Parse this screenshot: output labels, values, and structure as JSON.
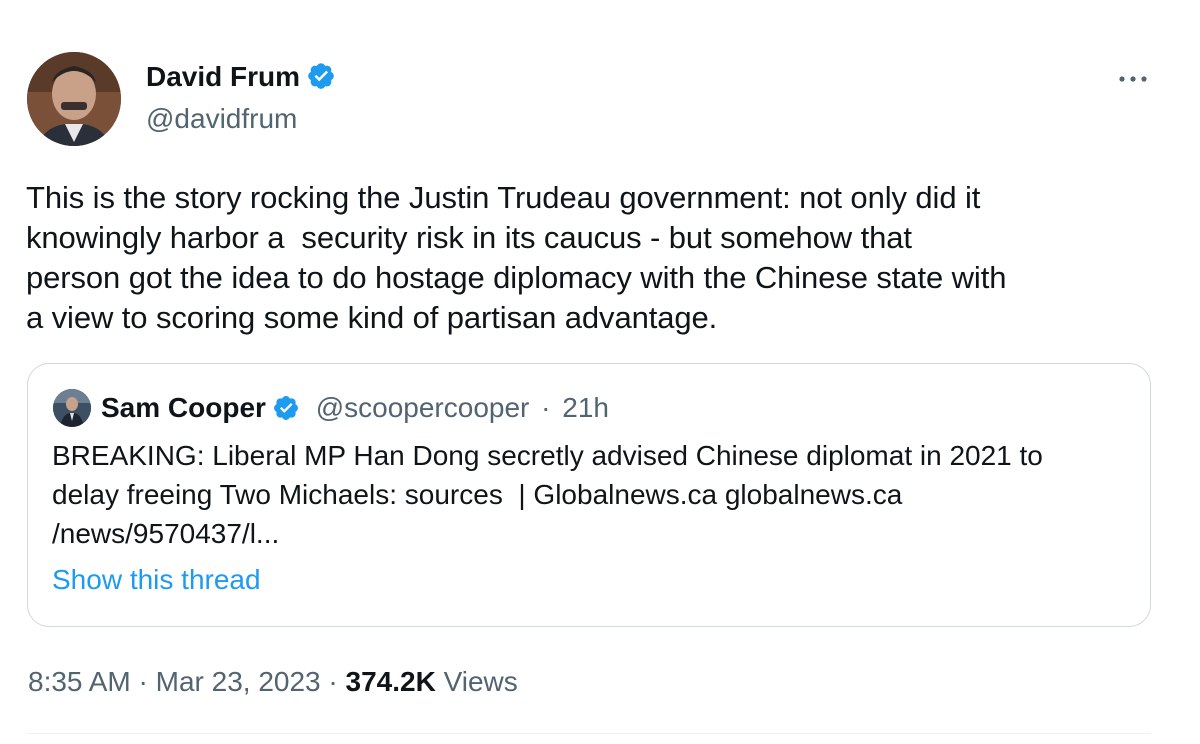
{
  "author": {
    "name": "David Frum",
    "handle": "@davidfrum",
    "verified_icon": "verified-badge-icon"
  },
  "more_icon": "more-options-icon",
  "tweet": {
    "lines": [
      "This is the story rocking the Justin Trudeau government: not only did it",
      "knowingly harbor a  security risk in its caucus - but somehow that",
      "person got the idea to do hostage diplomacy with the Chinese state with",
      "a view to scoring some kind of partisan advantage."
    ]
  },
  "quoted": {
    "name": "Sam Cooper",
    "handle": "@scoopercooper",
    "separator": "·",
    "time": "21h",
    "lines": [
      "BREAKING: Liberal MP Han Dong secretly advised Chinese diplomat in 2021 to",
      "delay freeing Two Michaels: sources  | Globalnews.ca globalnews.ca",
      "/news/9570437/l..."
    ],
    "show_thread": "Show this thread"
  },
  "meta": {
    "time": "8:35 AM",
    "sep1": "·",
    "date": "Mar 23, 2023",
    "sep2": "·",
    "views_count": "374.2K",
    "views_label": "Views"
  },
  "colors": {
    "accent": "#1d9bf0",
    "text": "#0f1419",
    "secondary": "#536471",
    "border": "#cfd9de"
  }
}
